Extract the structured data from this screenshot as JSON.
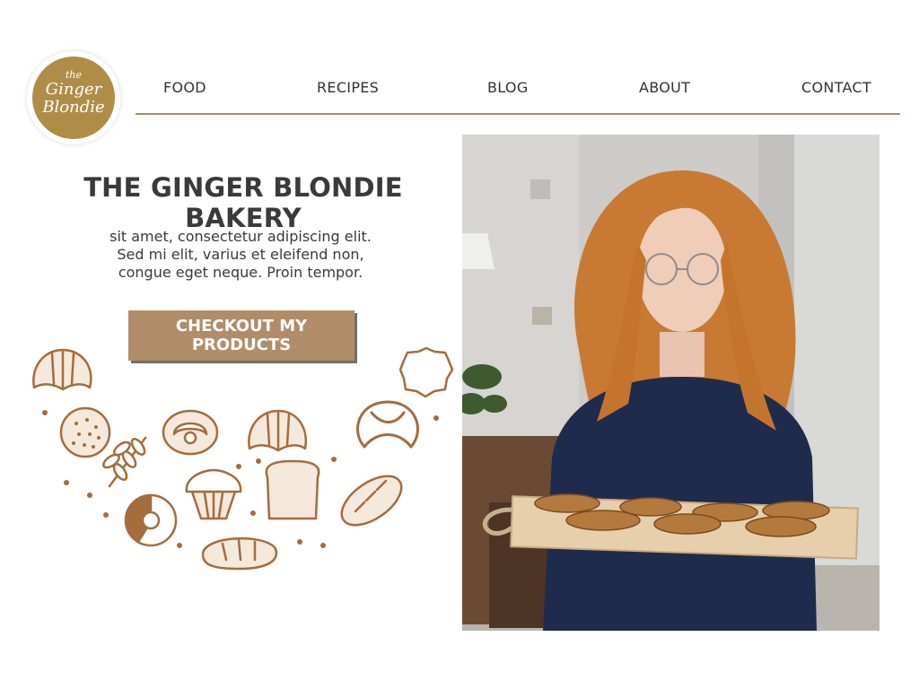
{
  "logo": {
    "line1": "the",
    "line2": "Ginger",
    "line3": "Blondie"
  },
  "nav": {
    "items": [
      "FOOD",
      "RECIPES",
      "BLOG",
      "ABOUT",
      "CONTACT"
    ]
  },
  "hero": {
    "title": "THE GINGER BLONDIE BAKERY",
    "description": "sit amet, consectetur adipiscing elit. Sed mi elit, varius et eleifend non, congue eget neque. Proin tempor.",
    "cta_label": "CHECKOUT MY PRODUCTS"
  },
  "colors": {
    "accent": "#b08d47",
    "button": "#b08d68",
    "line": "#a98c63",
    "illustration": "#a56c3c"
  },
  "icons": [
    "croissant-icon",
    "pie-icon",
    "cookie-icon",
    "wheat-icon",
    "danish-icon",
    "croissant-icon",
    "pretzel-icon",
    "muffin-icon",
    "bread-slice-icon",
    "baguette-icon",
    "donut-icon",
    "loaf-icon"
  ]
}
